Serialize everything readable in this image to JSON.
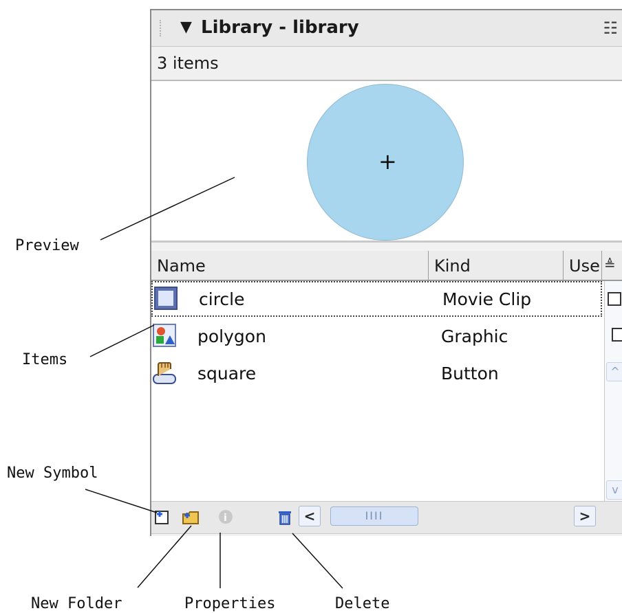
{
  "panel": {
    "title": "Library - library",
    "collapse_glyph": "▼",
    "menu_glyph": "☷",
    "item_count": "3 items",
    "preview_crosshair": "+"
  },
  "columns": [
    {
      "label": "Name"
    },
    {
      "label": "Kind"
    },
    {
      "label": "Use"
    }
  ],
  "sort_glyph": "≜",
  "items": [
    {
      "name": "circle",
      "kind": "Movie Clip",
      "icon": "movie-clip-icon",
      "selected": true
    },
    {
      "name": "polygon",
      "kind": "Graphic",
      "icon": "graphic-icon",
      "selected": false
    },
    {
      "name": "square",
      "kind": "Button",
      "icon": "button-symbol-icon",
      "selected": false
    }
  ],
  "scrollbar": {
    "left_arrow": "<",
    "right_arrow": ">",
    "thumb_grip": "IIII",
    "up_arrow": "^",
    "down_arrow": "v"
  },
  "annotations": {
    "preview": "Preview",
    "items": "Items",
    "new_symbol": "New Symbol",
    "new_folder": "New Folder",
    "properties": "Properties",
    "delete": "Delete"
  },
  "colors": {
    "preview_circle": "#a8d6ef",
    "panel_bg": "#f2f2f2"
  }
}
